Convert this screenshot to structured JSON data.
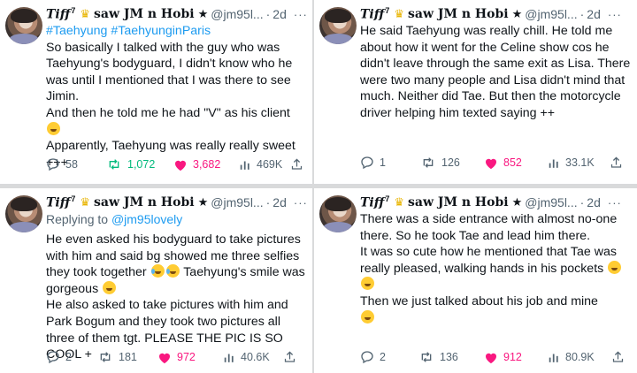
{
  "author": {
    "display": "Tiff",
    "display_sup": "7",
    "name": "saw JM n Hobi",
    "handle": "@jm95l...",
    "time": "2d",
    "more": "···"
  },
  "tweets": [
    {
      "hashtags": "#Taehyung #TaehyunginParis",
      "p1": "So basically I talked with the guy who was Taehyung's bodyguard, I didn't know who he was until I mentioned that I was there to see Jimin.",
      "p2": "And then he told me he had \"V\" as his client",
      "p3": "Apparently, Taehyung was really really sweet +++",
      "replies": "58",
      "retweets": "1,072",
      "likes": "3,682",
      "views": "469K"
    },
    {
      "p1": "He said Taehyung was really chill. He told me about how it went for the Celine show cos he didn't leave through the same exit as Lisa. There were two many people and Lisa didn't mind that much. Neither did Tae. But then the motorcycle driver helping him texted saying ++",
      "replies": "1",
      "retweets": "126",
      "likes": "852",
      "views": "33.1K"
    },
    {
      "reply_prefix": "Replying to ",
      "reply_handle": "@jm95lovely",
      "p1a": "He even asked his bodyguard to take pictures with him and said bg showed me three selfies they took together",
      "p1b": "Taehyung's smile was gorgeous",
      "p2": "He also asked to take pictures with him and Park Bogum and they took two pictures all three of them tgt. PLEASE THE PIC IS SO COOL +",
      "replies": "2",
      "retweets": "181",
      "likes": "972",
      "views": "40.6K"
    },
    {
      "p1": "There was a side entrance with almost no-one there. So he took Tae and lead him there.",
      "p2": "It was so cute how he mentioned that Tae was really pleased, walking hands in his pockets",
      "p3": "Then we just talked about his job and mine",
      "replies": "2",
      "retweets": "136",
      "likes": "912",
      "views": "80.9K"
    }
  ],
  "colors": {
    "link": "#1d9bf0",
    "retweet": "#00ba7c",
    "like": "#f91880",
    "muted": "#536471"
  },
  "icons": [
    "crown-emoji-icon",
    "star-icon",
    "reply-icon",
    "retweet-icon",
    "like-icon",
    "views-icon",
    "share-icon",
    "more-icon"
  ]
}
